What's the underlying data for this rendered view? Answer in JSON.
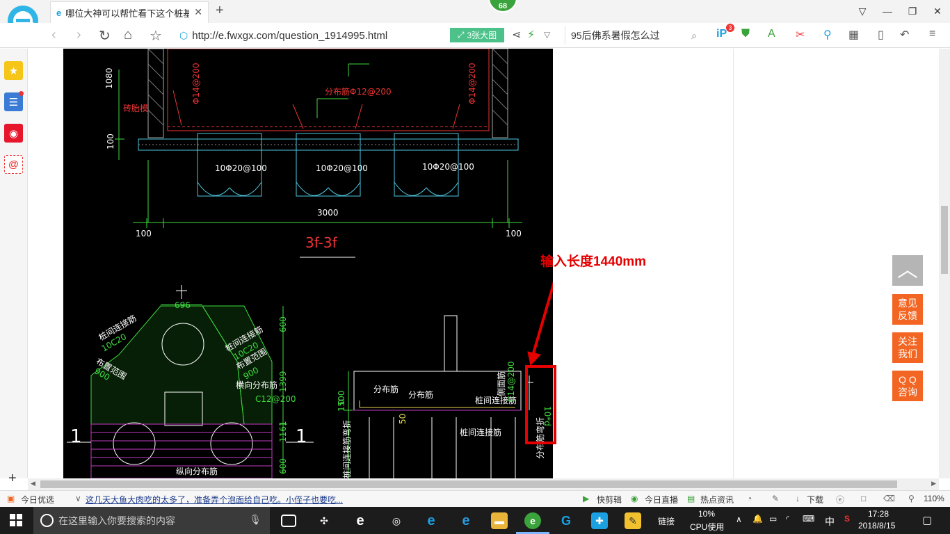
{
  "browser": {
    "tab": {
      "title": "哪位大神可以帮忙看下这个桩基础",
      "close": "✕"
    },
    "new_tab": "+",
    "score_badge": "68",
    "window_controls": [
      "▽",
      "—",
      "❐",
      "✕"
    ],
    "url": "http://e.fwxgx.com/question_1914995.html",
    "big_image_button": "3张大图",
    "search_text": "95后佛系暑假怎么过",
    "zoom": "110%",
    "ip_badge": "3"
  },
  "cad": {
    "section_label": "3f-3f",
    "dim_1080": "1080",
    "dim_100_left": "100",
    "dim_3000": "3000",
    "dim_100_a": "100",
    "dim_100_b": "100",
    "rebar_left": "Φ14@200",
    "rebar_right": "Φ14@200",
    "dist_bar": "分布筋Φ12@200",
    "brick": "砖胎模",
    "bottom_bars": [
      "10Φ20@100",
      "10Φ20@100",
      "10Φ20@100"
    ],
    "top_dim": "696",
    "tie_left": "桩间连接筋",
    "tie_left_spec": "10C20",
    "range_left": "布置范围",
    "range_left_val": "900",
    "tie_right": "桩间连接筋",
    "tie_right_spec": "10C20",
    "range_right": "布置范围",
    "range_right_val": "900",
    "horiz_dist": "横向分布筋",
    "horiz_spec": "C12@200",
    "long_dist": "纵向分布筋",
    "mark_1_left": "1",
    "mark_1_right": "1",
    "dim_600_top": "600",
    "dim_1399": "1399",
    "dim_1161": "1161",
    "dim_600_bot": "600",
    "d_dist1": "分布筋",
    "d_dist2": "分布筋",
    "d_tie": "桩间连接筋",
    "d_tie2": "桩间连接筋",
    "d_side": "侧面筋",
    "d_side_spec": "C14@200",
    "d_1500": "1500",
    "d_0": "0",
    "d_50": "50",
    "d_vert": "桩间连接筋弯折",
    "d_10d": "10*d",
    "d_bend": "分布筋弯折"
  },
  "annotation": "输入长度1440mm",
  "float_buttons": {
    "totop": "︿",
    "feedback": "意见\n反馈",
    "follow": "关注\n我们",
    "qq": "Q Q\n咨询"
  },
  "statusbar": {
    "today": "今日优选",
    "news": "这几天大鱼大肉吃的太多了，准备弄个泡面给自己吃。小侄子也要吃...",
    "clip": "快剪辑",
    "live": "今日直播",
    "hot": "热点资讯",
    "download": "下载"
  },
  "taskbar": {
    "search_placeholder": "在这里输入你要搜索的内容",
    "link": "链接",
    "cpu_percent": "10%",
    "cpu_label": "CPU使用",
    "ime": "中",
    "time": "17:28",
    "date": "2018/8/15"
  },
  "colors": {
    "cad_bg": "#000000",
    "annot_red": "#e60000",
    "orange_btn": "#f26522",
    "green_badge": "#3ba33b"
  }
}
